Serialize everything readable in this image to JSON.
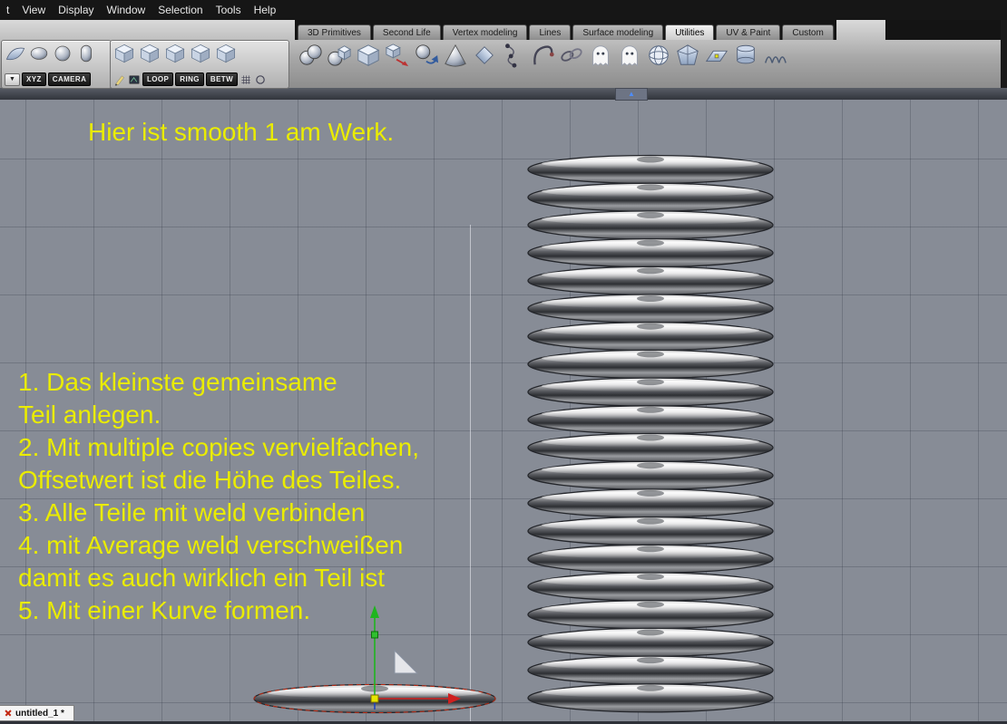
{
  "menu": {
    "items": [
      "t",
      "View",
      "Display",
      "Window",
      "Selection",
      "Tools",
      "Help"
    ]
  },
  "tab_bar": {
    "tabs": [
      {
        "label": "3D Primitives",
        "active": false
      },
      {
        "label": "Second Life",
        "active": false
      },
      {
        "label": "Vertex modeling",
        "active": false
      },
      {
        "label": "Lines",
        "active": false
      },
      {
        "label": "Surface modeling",
        "active": false
      },
      {
        "label": "Utilities",
        "active": true
      },
      {
        "label": "UV & Paint",
        "active": false
      },
      {
        "label": "Custom",
        "active": false
      }
    ]
  },
  "toolbar": {
    "collapse_arrow": "▲",
    "icons": [
      {
        "name": "symmetry-icon",
        "type": "spheres"
      },
      {
        "name": "clone-icon",
        "type": "spherecube"
      },
      {
        "name": "multiple-copies-icon",
        "type": "cube"
      },
      {
        "name": "copy-on-support-icon",
        "type": "cubearrow"
      },
      {
        "name": "throw-copies-icon",
        "type": "spherearrow"
      },
      {
        "name": "cone-deform-icon",
        "type": "cone"
      },
      {
        "name": "taper-icon",
        "type": "diamond"
      },
      {
        "name": "twist-icon",
        "type": "dots"
      },
      {
        "name": "bend-icon",
        "type": "hook"
      },
      {
        "name": "chain-icon",
        "type": "chain"
      },
      {
        "name": "hide-icon",
        "type": "ghost"
      },
      {
        "name": "show-icon",
        "type": "ghost"
      },
      {
        "name": "sphere-project-icon",
        "type": "globe"
      },
      {
        "name": "prism-icon",
        "type": "prism"
      },
      {
        "name": "deformer-icon",
        "type": "planedeform"
      },
      {
        "name": "disc-stack-icon",
        "type": "cylstack"
      },
      {
        "name": "wave-deform-icon",
        "type": "wave"
      }
    ]
  },
  "left_panel": {
    "dropdown_arrow": "▼",
    "primitive_icons": [
      {
        "name": "surface-tool-icon",
        "type": "plane"
      },
      {
        "name": "disc-tool-icon",
        "type": "disc"
      },
      {
        "name": "sphere-tool-icon",
        "type": "sphere"
      },
      {
        "name": "capsule-tool-icon",
        "type": "capsule"
      }
    ],
    "view_buttons": [
      "XYZ",
      "CAMERA"
    ],
    "selection_icons": [
      {
        "name": "select-vertex-icon",
        "type": "cube"
      },
      {
        "name": "select-edge-icon",
        "type": "cube"
      },
      {
        "name": "select-face-icon",
        "type": "cube"
      },
      {
        "name": "select-object-icon",
        "type": "cube"
      },
      {
        "name": "select-all-icon",
        "type": "cube"
      }
    ],
    "selection_row2": [
      {
        "kind": "icon",
        "name": "pencil-icon",
        "type": "pencil"
      },
      {
        "kind": "icon",
        "name": "swatch-icon",
        "type": "swatch"
      },
      {
        "kind": "button",
        "label": "LOOP"
      },
      {
        "kind": "button",
        "label": "RING"
      },
      {
        "kind": "button",
        "label": "BETW"
      },
      {
        "kind": "icon",
        "name": "grid-icon",
        "type": "grid"
      },
      {
        "kind": "icon",
        "name": "ring-select-icon",
        "type": "ring"
      }
    ]
  },
  "viewport": {
    "title_text": "Hier ist smooth 1 am Werk.",
    "text_color": "#eaec00",
    "instructions": [
      "1. Das kleinste gemeinsame",
      "Teil anlegen.",
      "2. Mit multiple copies vervielfachen,",
      "Offsetwert ist die Höhe des Teiles.",
      "3. Alle Teile mit weld verbinden",
      "4. mit Average weld verschweißen",
      "damit es auch wirklich ein Teil ist",
      "5. Mit einer Kurve formen."
    ],
    "stack_ring_count": 20
  },
  "status": {
    "document_tab": "untitled_1 *"
  }
}
